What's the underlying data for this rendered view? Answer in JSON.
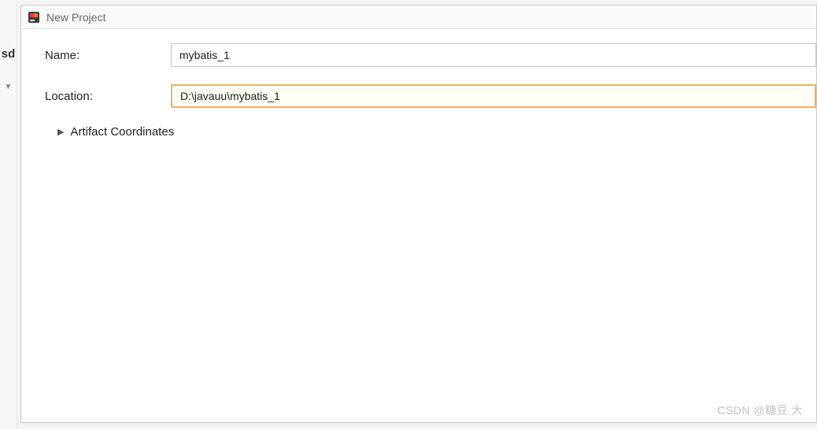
{
  "titlebar": {
    "title": "New Project"
  },
  "leftStrip": {
    "text": "sd"
  },
  "form": {
    "nameLabel": "Name:",
    "nameValue": "mybatis_1",
    "locationLabel": "Location:",
    "locationValue": "D:\\javauu\\mybatis_1"
  },
  "expander": {
    "label": "Artifact Coordinates"
  },
  "watermark": "CSDN @糖豆    大"
}
